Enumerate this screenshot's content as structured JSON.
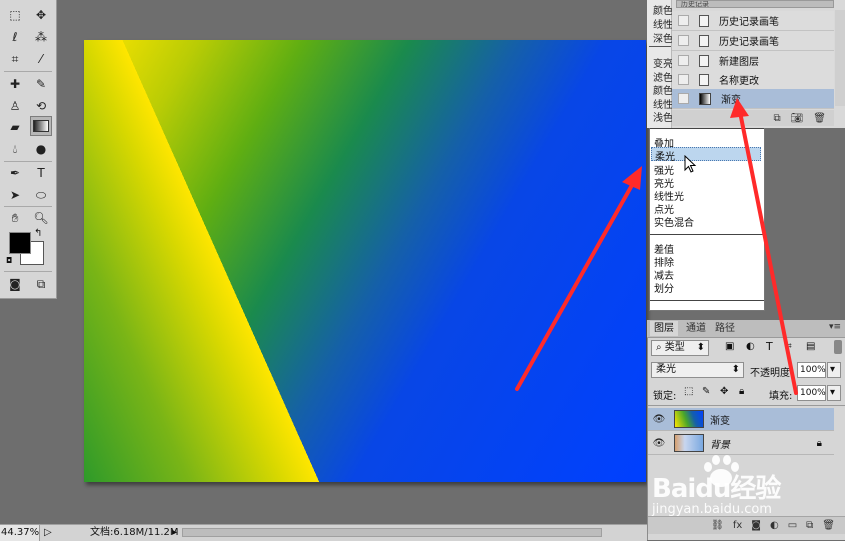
{
  "toolbox": {
    "tools": [
      "marquee-tool",
      "move-tool",
      "lasso-tool",
      "magic-wand-tool",
      "crop-tool",
      "eyedropper-tool",
      "healing-brush-tool",
      "brush-tool",
      "clone-stamp-tool",
      "history-brush-tool",
      "eraser-tool",
      "gradient-tool",
      "blur-tool",
      "dodge-tool",
      "pen-tool",
      "type-tool",
      "path-selection-tool",
      "ellipse-tool",
      "hand-tool",
      "zoom-tool"
    ],
    "foreground_color": "#000000",
    "background_color": "#ffffff"
  },
  "canvas": {
    "gradient_colors": [
      "#ffe600",
      "#7ab516",
      "#1a8a4d",
      "#0040ff"
    ]
  },
  "history_panel": {
    "header_text": "历史记录",
    "left_cut_labels": [
      "颜色",
      "线性",
      "深色",
      "变亮",
      "滤色",
      "颜色",
      "线性",
      "浅色"
    ],
    "items": [
      {
        "label": "历史记录画笔",
        "icon": "document-icon"
      },
      {
        "label": "历史记录画笔",
        "icon": "document-icon"
      },
      {
        "label": "新建图层",
        "icon": "document-icon"
      },
      {
        "label": "名称更改",
        "icon": "document-icon"
      },
      {
        "label": "渐变",
        "icon": "gradient-icon"
      }
    ]
  },
  "blend_mode_list": {
    "group1": [
      "叠加",
      "柔光",
      "强光",
      "亮光",
      "线性光",
      "点光",
      "实色混合"
    ],
    "group2": [
      "差值",
      "排除",
      "减去",
      "划分"
    ],
    "selected": "柔光"
  },
  "layers_panel": {
    "tabs": [
      "图层",
      "通道",
      "路径"
    ],
    "filter_label": "类型",
    "blend_mode": "柔光",
    "opacity_label": "不透明度:",
    "opacity_value": "100%",
    "lock_label": "锁定:",
    "fill_label": "填充:",
    "fill_value": "100%",
    "layers": [
      {
        "name": "渐变",
        "selected": true
      },
      {
        "name": "背景",
        "selected": false,
        "locked": true
      }
    ]
  },
  "status_bar": {
    "zoom": "44.37%",
    "doc_info": "文档:6.18M/11.2M"
  },
  "watermark": {
    "brand": "Baidu经验",
    "url": "jingyan.baidu.com"
  },
  "annotation": {
    "arrow_color": "#ff2a2a"
  }
}
